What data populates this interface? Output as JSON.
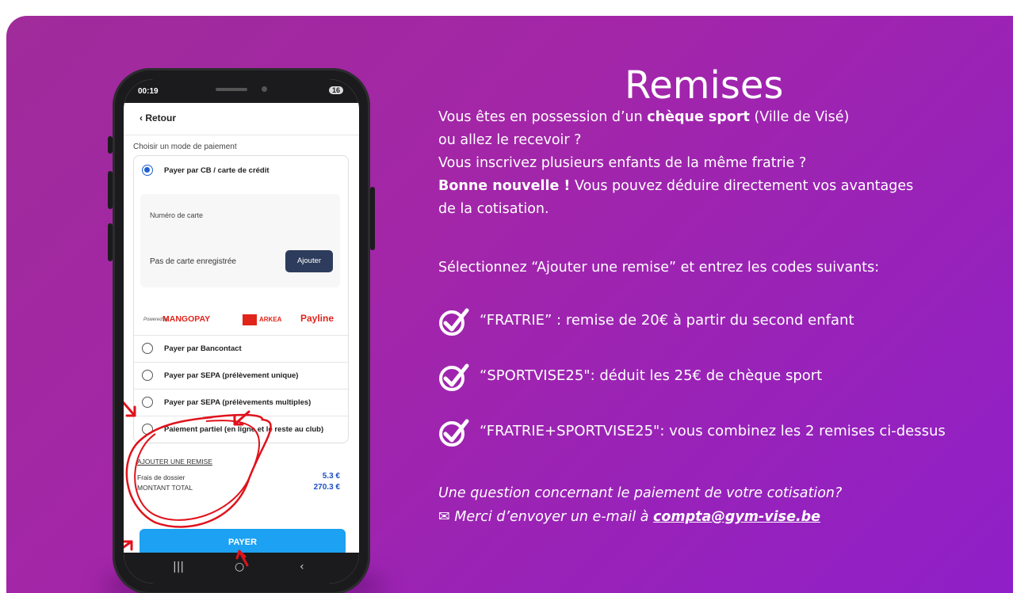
{
  "phone": {
    "status_time": "00:19",
    "battery": "16",
    "back_label": "Retour",
    "section_label": "Choisir un mode de paiement",
    "methods": [
      {
        "label": "Payer par CB / carte de crédit",
        "selected": true
      },
      {
        "label": "Payer par Bancontact",
        "selected": false
      },
      {
        "label": "Payer par SEPA (prélèvement unique)",
        "selected": false
      },
      {
        "label": "Payer par SEPA (prélèvements multiples)",
        "selected": false
      },
      {
        "label": "Paiement partiel (en ligne et le reste au club)",
        "selected": false
      }
    ],
    "card_number_label": "Numéro de carte",
    "no_card_label": "Pas de carte enregistrée",
    "add_button": "Ajouter",
    "brands": {
      "powered_by": "Powered by",
      "mangopay": "MANGOPAY",
      "arkea": "ARKEA",
      "payline": "Payline"
    },
    "add_discount_link": "AJOUTER UNE REMISE",
    "fees_label": "Frais de dossier",
    "fees_value": "5.3 €",
    "total_label": "MONTANT TOTAL",
    "total_value": "270.3 €",
    "pay_button": "PAYER",
    "accent_color": "#1da1f2"
  },
  "info": {
    "title": "Remises",
    "p1a": "Vous êtes en possession d’un ",
    "p1b": "chèque sport",
    "p1c": " (Ville de Visé)",
    "p2": "ou allez le recevoir ?",
    "p3": "Vous inscrivez plusieurs enfants de la même fratrie ?",
    "p4a": "Bonne nouvelle !",
    "p4b": " Vous pouvez déduire directement vos avantages",
    "p5": "de la cotisation.",
    "instruction": "Sélectionnez “Ajouter une remise” et entrez les codes suivants:",
    "codes": [
      "“FRATRIE” : remise de 20€ à partir du second enfant",
      "“SPORTVISE25\": déduit les 25€ de chèque sport",
      "“FRATRIE+SPORTVISE25\": vous combinez les 2 remises ci-dessus"
    ],
    "question": "Une question concernant le paiement de votre cotisation?",
    "contact_prefix": "Merci d’envoyer un e-mail à ",
    "email": "compta@gym-vise.be"
  },
  "colors": {
    "background_start": "#a02b9a",
    "background_end": "#8f1fc8",
    "annotation_red": "#e0121c"
  }
}
